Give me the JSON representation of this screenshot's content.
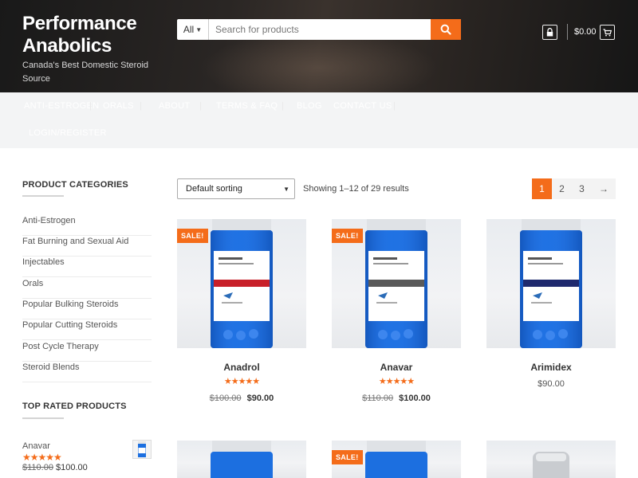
{
  "header": {
    "site_title": "Performance Anabolics",
    "tagline": "Canada's Best Domestic Steroid Source",
    "search_category": "All",
    "search_placeholder": "Search for products",
    "cart_total": "$0.00"
  },
  "nav": {
    "items": [
      "ANTI-ESTROGEN",
      "ORALS",
      "ABOUT",
      "TERMS & FAQ",
      "BLOG",
      "CONTACT US",
      "LOGIN/REGISTER"
    ]
  },
  "sidebar": {
    "categories_title": "PRODUCT CATEGORIES",
    "categories": [
      "Anti-Estrogen",
      "Fat Burning and Sexual Aid",
      "Injectables",
      "Orals",
      "Popular Bulking Steroids",
      "Popular Cutting Steroids",
      "Post Cycle Therapy",
      "Steroid Blends"
    ],
    "top_rated_title": "TOP RATED PRODUCTS",
    "top_rated": [
      {
        "name": "Anavar",
        "rating": 5,
        "old_price": "$110.00",
        "price": "$100.00"
      }
    ]
  },
  "shop": {
    "sort_label": "Default sorting",
    "result_count": "Showing 1–12 of 29 results",
    "pages": [
      "1",
      "2",
      "3",
      "→"
    ],
    "current_page": "1",
    "sale_badge": "SALE!"
  },
  "products": [
    {
      "name": "Anadrol",
      "sale": true,
      "rating": 5,
      "old_price": "$100.00",
      "price": "$90.00",
      "label_color": "#c8202a"
    },
    {
      "name": "Anavar",
      "sale": true,
      "rating": 5,
      "old_price": "$110.00",
      "price": "$100.00",
      "label_color": "#5a5a5a"
    },
    {
      "name": "Arimidex",
      "sale": false,
      "rating": 0,
      "old_price": "",
      "price": "$90.00",
      "label_color": "#1f2a6e"
    }
  ],
  "colors": {
    "accent": "#f46c1a",
    "bottle_blue": "#1c6fe0"
  }
}
